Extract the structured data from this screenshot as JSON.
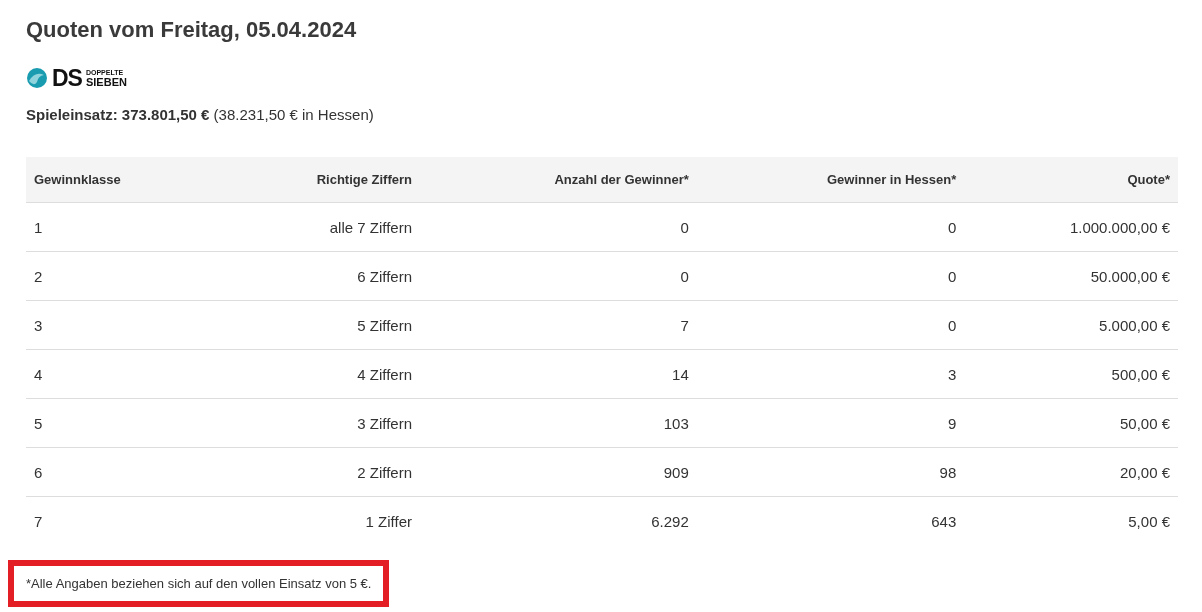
{
  "title": "Quoten vom Freitag, 05.04.2024",
  "logo": {
    "mark": "DS",
    "line_1": "DOPPELTE",
    "line_2": "SIEBEN"
  },
  "stake": "**Spieleinsatz: 373.801,50 €** (38.231,50 € in Hessen)",
  "table": {
    "columns": [
      "Gewinnklasse",
      "Richtige Ziffern",
      "Anzahl der Gewinner*",
      "Gewinner in Hessen*",
      "Quote*"
    ],
    "rows": [
      [
        "1",
        "alle 7 Ziffern",
        "0",
        "0",
        "1.000.000,00 €"
      ],
      [
        "2",
        "6 Ziffern",
        "0",
        "0",
        "50.000,00 €"
      ],
      [
        "3",
        "5 Ziffern",
        "7",
        "0",
        "5.000,00 €"
      ],
      [
        "4",
        "4 Ziffern",
        "14",
        "3",
        "500,00 €"
      ],
      [
        "5",
        "3 Ziffern",
        "103",
        "9",
        "50,00 €"
      ],
      [
        "6",
        "2 Ziffern",
        "909",
        "98",
        "20,00 €"
      ],
      [
        "7",
        "1 Ziffer",
        "6.292",
        "643",
        "5,00 €"
      ]
    ]
  },
  "footnote": {
    "text": "*Alle Angaben beziehen sich auf den vollen Einsatz von 5 €.",
    "highlighted": true
  }
}
